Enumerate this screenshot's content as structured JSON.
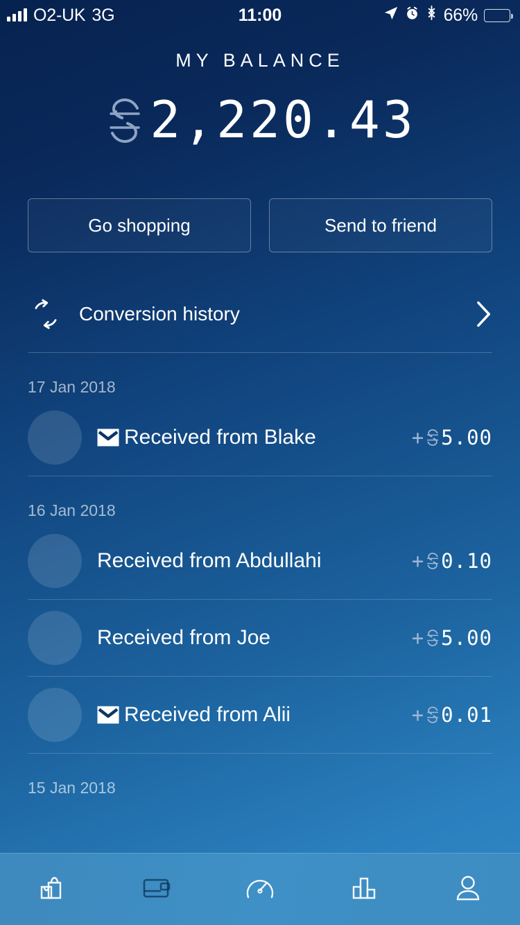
{
  "status_bar": {
    "carrier": "O2-UK",
    "network": "3G",
    "time": "11:00",
    "battery_percent": "66%",
    "battery_level": 66,
    "icons": [
      "signal-bars-icon",
      "location-arrow-icon",
      "alarm-clock-icon",
      "bluetooth-icon",
      "battery-icon"
    ]
  },
  "header": {
    "title": "MY BALANCE",
    "currency_symbol": "S",
    "balance": "2,220.43"
  },
  "actions": {
    "go_shopping": "Go shopping",
    "send_to_friend": "Send to friend"
  },
  "conversion": {
    "label": "Conversion history",
    "icon": "refresh-cycle-icon",
    "chevron": "chevron-right-icon"
  },
  "transactions": {
    "groups": [
      {
        "date": "17 Jan 2018",
        "items": [
          {
            "label": "Received from Blake",
            "has_message": true,
            "sign": "+",
            "currency": "S",
            "amount": "5.00"
          }
        ]
      },
      {
        "date": "16 Jan 2018",
        "items": [
          {
            "label": "Received from Abdullahi",
            "has_message": false,
            "sign": "+",
            "currency": "S",
            "amount": "0.10"
          },
          {
            "label": "Received from Joe",
            "has_message": false,
            "sign": "+",
            "currency": "S",
            "amount": "5.00"
          },
          {
            "label": "Received from Alii",
            "has_message": true,
            "sign": "+",
            "currency": "S",
            "amount": "0.01"
          }
        ]
      },
      {
        "date": "15 Jan 2018",
        "items": []
      }
    ]
  },
  "tabbar": {
    "items": [
      {
        "name": "shopping-bags-icon",
        "active": false
      },
      {
        "name": "wallet-icon",
        "active": true
      },
      {
        "name": "speedometer-icon",
        "active": false
      },
      {
        "name": "bar-chart-icon",
        "active": false
      },
      {
        "name": "person-icon",
        "active": false
      }
    ]
  },
  "colors": {
    "bg_top": "#06224f",
    "bg_bottom": "#3189c5",
    "tabbar": "#3f90c6",
    "accent_muted": "#9fb6d4",
    "text": "#ffffff"
  }
}
